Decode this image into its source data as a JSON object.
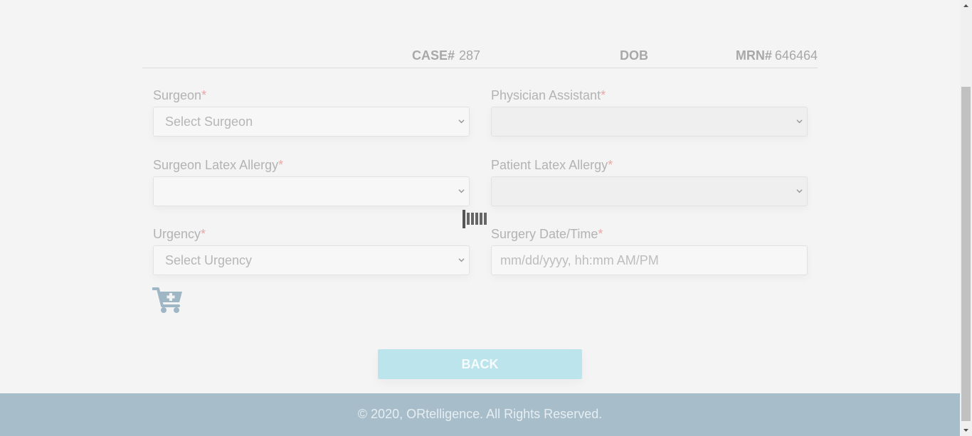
{
  "case_header": {
    "case_label": "CASE#",
    "case_value": "287",
    "dob_label": "DOB",
    "mrn_label": "MRN#",
    "mrn_value": "646464"
  },
  "form": {
    "required_marker": "*",
    "surgeon": {
      "label": "Surgeon",
      "selected": "Select Surgeon"
    },
    "physician_assistant": {
      "label": "Physician Assistant",
      "selected": ""
    },
    "surgeon_latex_allergy": {
      "label": "Surgeon Latex Allergy",
      "selected": ""
    },
    "patient_latex_allergy": {
      "label": "Patient Latex Allergy",
      "selected": ""
    },
    "urgency": {
      "label": "Urgency",
      "selected": "Select Urgency"
    },
    "surgery_datetime": {
      "label": "Surgery Date/Time",
      "placeholder": "mm/dd/yyyy, hh:mm AM/PM"
    }
  },
  "icons": {
    "cart": "cart-plus-icon",
    "spinner": "loading-spinner-icon"
  },
  "buttons": {
    "back_label": "BACK"
  },
  "footer": {
    "text": "© 2020, ORtelligence. All Rights Reserved."
  },
  "colors": {
    "footer_bg": "#a7bdca",
    "back_button_bg": "#bce4ec",
    "cart_icon": "#9fb6c5",
    "required": "#e8a7a7"
  }
}
